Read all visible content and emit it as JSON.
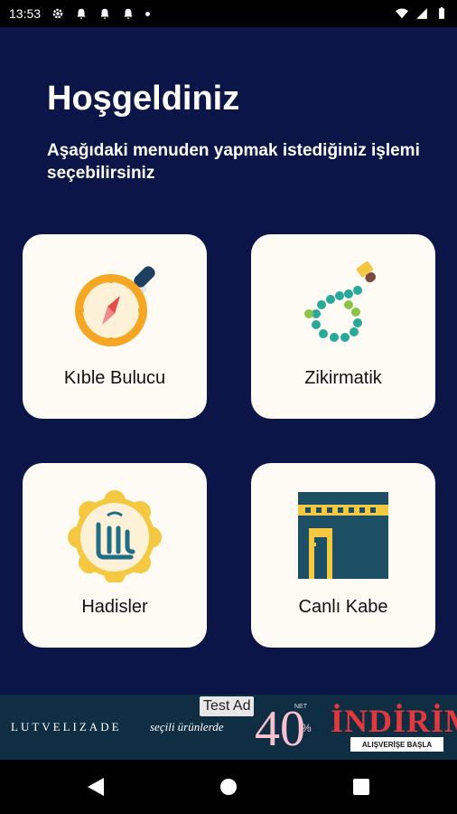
{
  "status_bar": {
    "time": "13:53",
    "left_icons": [
      "gear-icon",
      "bell-icon",
      "bell-icon",
      "bell-icon",
      "dot-icon"
    ],
    "right_icons": [
      "wifi-icon",
      "signal-icon",
      "battery-icon"
    ]
  },
  "header": {
    "title": "Hoşgeldiniz",
    "subtitle": "Aşağıdaki menuden yapmak istediğiniz işlemi seçebilirsiniz"
  },
  "menu": [
    {
      "label": "Kıble Bulucu",
      "icon": "compass-icon"
    },
    {
      "label": "Zikirmatik",
      "icon": "prayer-beads-icon"
    },
    {
      "label": "Hadisler",
      "icon": "allah-calligraphy-icon"
    },
    {
      "label": "Canlı Kabe",
      "icon": "kaaba-icon"
    }
  ],
  "ad": {
    "tag": "Test Ad",
    "brand": "LUTVELIZADE",
    "subtitle": "seçili ürünlerde",
    "number": "40",
    "net": "NET",
    "percent": "%",
    "sale": "İNDİRİM",
    "cta": "ALIŞVERİŞE BAŞLA"
  },
  "colors": {
    "background": "#0b1547",
    "card": "#fdfbf3",
    "accent_orange": "#f5a623",
    "accent_teal": "#1f8a8a",
    "ad_red": "#e3393b"
  },
  "nav": [
    "back-icon",
    "home-icon",
    "recents-icon"
  ]
}
